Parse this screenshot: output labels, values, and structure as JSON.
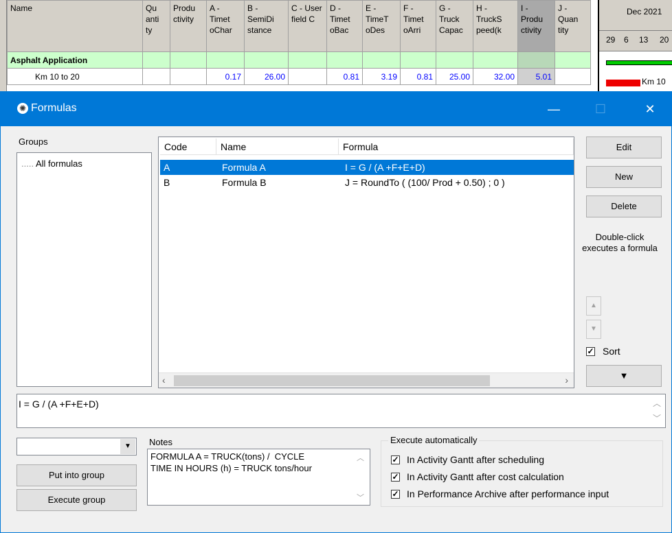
{
  "sheet": {
    "columns": [
      "Name",
      "Qu anti ty",
      "Produ ctivity",
      "A - Timet oChar",
      "B - SemiDi stance",
      "C - User field C",
      "D - Timet oBac",
      "E - TimeT oDes",
      "F - Timet oArri",
      "G - Truck Capac",
      "H - TruckS peed(k",
      "I - Produ ctivity",
      "J - Quan tity"
    ],
    "group_row": "Asphalt Application",
    "activity_row": {
      "name": "Km 10 to 20",
      "a": "0.17",
      "b": "26.00",
      "d": "0.81",
      "e": "3.19",
      "f": "0.81",
      "g": "25.00",
      "h": "32.00",
      "i": "5.01"
    },
    "gantt": {
      "month": "Dec 2021",
      "days": [
        "29",
        "6",
        "13",
        "20"
      ],
      "bar_label": "Km 10"
    }
  },
  "dialog": {
    "title": "Formulas",
    "groups_label": "Groups",
    "groups": [
      "All formulas"
    ],
    "table": {
      "headers": {
        "code": "Code",
        "name": "Name",
        "formula": "Formula"
      },
      "rows": [
        {
          "code": "A",
          "name": "Formula A",
          "formula": "I = G / (A +F+E+D)"
        },
        {
          "code": "B",
          "name": "Formula B",
          "formula": "J = RoundTo ( (100/ Prod + 0.50) ; 0 )"
        }
      ]
    },
    "buttons": {
      "edit": "Edit",
      "new": "New",
      "delete": "Delete",
      "put_into_group": "Put into group",
      "execute_group": "Execute group"
    },
    "hint": "Double-click executes a formula",
    "sort_label": "Sort",
    "preview_formula": "I = G / (A +F+E+D)",
    "notes_label": "Notes",
    "notes_text": "FORMULA A = TRUCK(tons) /  CYCLE\nTIME IN HOURS (h) = TRUCK tons/hour",
    "exec_auto": {
      "legend": "Execute automatically",
      "options": [
        "In Activity Gantt after scheduling",
        "In Activity Gantt after cost calculation",
        "In Performance Archive after performance input"
      ]
    }
  }
}
